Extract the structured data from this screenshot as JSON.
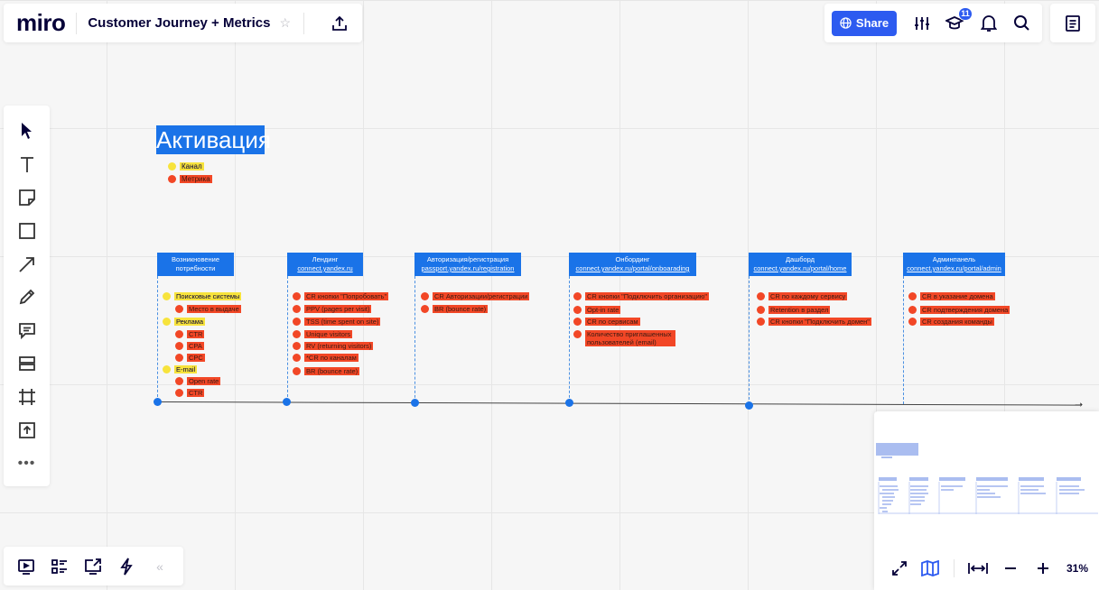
{
  "app": {
    "logo": "miro",
    "board_title": "Customer Journey + Metrics",
    "share_label": "Share",
    "notification_badge": "11",
    "zoom": "31%"
  },
  "colors": {
    "accent": "#2d5bf0",
    "stage_blue": "#1a73e8",
    "channel_yellow": "#f7e33c",
    "metric_red": "#f24726"
  },
  "board": {
    "title": "Активация",
    "legend": [
      {
        "label": "Канал",
        "kind": "channel"
      },
      {
        "label": "Метрика",
        "kind": "metric"
      }
    ],
    "stages": [
      {
        "name": "Возникновение потребности",
        "link": ""
      },
      {
        "name": "Лендинг",
        "link": "connect.yandex.ru"
      },
      {
        "name": "Авторизация/регистрация",
        "link": "passport.yandex.ru/registration"
      },
      {
        "name": "Онбординг",
        "link": "connect.yandex.ru/portal/onboarading"
      },
      {
        "name": "Дашборд",
        "link": "connect.yandex.ru/portal/home"
      },
      {
        "name": "Админпанель",
        "link": "connect.yandex.ru/portal/admin"
      }
    ],
    "stage1_items": [
      {
        "label": "Поисковые системы",
        "kind": "channel"
      },
      {
        "label": "Место в выдаче",
        "kind": "metric"
      },
      {
        "label": "Реклама",
        "kind": "channel"
      },
      {
        "label": "CTR",
        "kind": "metric"
      },
      {
        "label": "CPA",
        "kind": "metric"
      },
      {
        "label": "CPC",
        "kind": "metric"
      },
      {
        "label": "E-mail",
        "kind": "channel"
      },
      {
        "label": "Open rate",
        "kind": "metric"
      },
      {
        "label": "CTR",
        "kind": "metric"
      }
    ],
    "stage2_items": [
      "CR кнопки \"Попробовать\"",
      "PPV (pages per visit)",
      "TSS (time spent on site)",
      "Unique visitors",
      "RV (returning visitors)",
      "*CR по каналам",
      "BR (bounce rate)"
    ],
    "stage3_items": [
      "CR Авторизации/регистрации",
      "BR (bounce rate)"
    ],
    "stage4_items": [
      "CR кнопки \"Подключить организацию\"",
      "Opt-in rate",
      "CR по сервисам",
      "Количество приглашенных пользователей (email)"
    ],
    "stage5_items": [
      "CR по каждому сервису",
      "Retention в раздел",
      "CR кнопки \"Подключить домен\""
    ],
    "stage6_items": [
      "CR в указание домена",
      "CR подтверждения домена",
      "CR создания команды"
    ]
  }
}
